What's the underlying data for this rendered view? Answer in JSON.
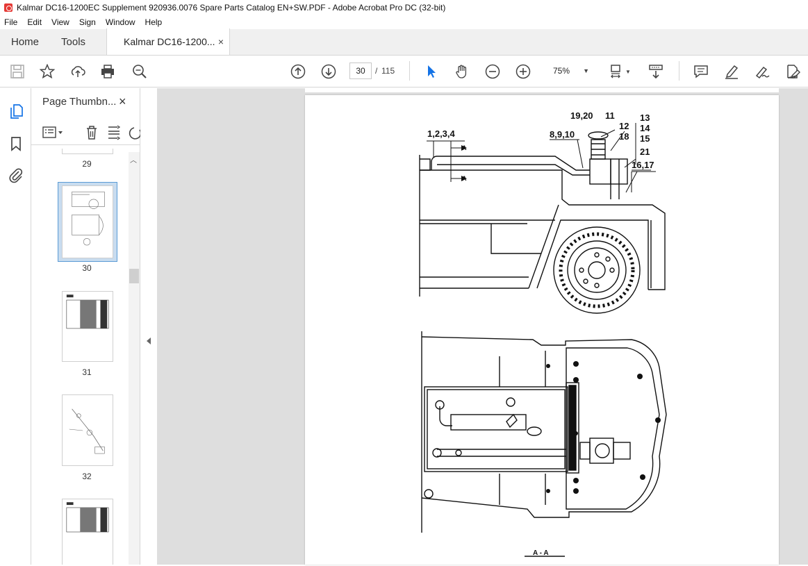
{
  "window": {
    "title": "Kalmar DC16-1200EC Supplement 920936.0076 Spare Parts Catalog EN+SW.PDF - Adobe Acrobat Pro DC (32-bit)"
  },
  "menu": [
    "File",
    "Edit",
    "View",
    "Sign",
    "Window",
    "Help"
  ],
  "tabs": {
    "home": "Home",
    "tools": "Tools",
    "document": "Kalmar DC16-1200...",
    "close": "×"
  },
  "toolbar": {
    "page_current": "30",
    "page_sep": "/",
    "page_total": "115",
    "zoom": "75%",
    "icons": [
      "save-icon",
      "star-icon",
      "upload-icon",
      "print-icon",
      "zoom-search-icon",
      "arrow-up-icon",
      "arrow-down-icon",
      "select-cursor-icon",
      "hand-icon",
      "zoom-out-icon",
      "zoom-in-icon",
      "fit-page-icon",
      "scroll-mode-icon",
      "comment-icon",
      "highlight-pen-icon",
      "sign-icon",
      "edit-pdf-icon"
    ]
  },
  "sidebar": {
    "panel_title": "Page Thumbn...",
    "panel_close": "×",
    "thumbnails": [
      {
        "label": "29"
      },
      {
        "label": "30",
        "selected": true
      },
      {
        "label": "31"
      },
      {
        "label": "32"
      },
      {
        "label": ""
      }
    ]
  },
  "drawing": {
    "labels": {
      "l1": "1,2,3,4",
      "l2": "19,20",
      "l3": "11",
      "l4": "13",
      "l5": "12",
      "l6": "14",
      "l7": "8,9,10",
      "l8": "18",
      "l9": "15",
      "l10": "21",
      "l11": "16,17",
      "a1": "A",
      "a2": "A",
      "section": "A - A"
    }
  }
}
